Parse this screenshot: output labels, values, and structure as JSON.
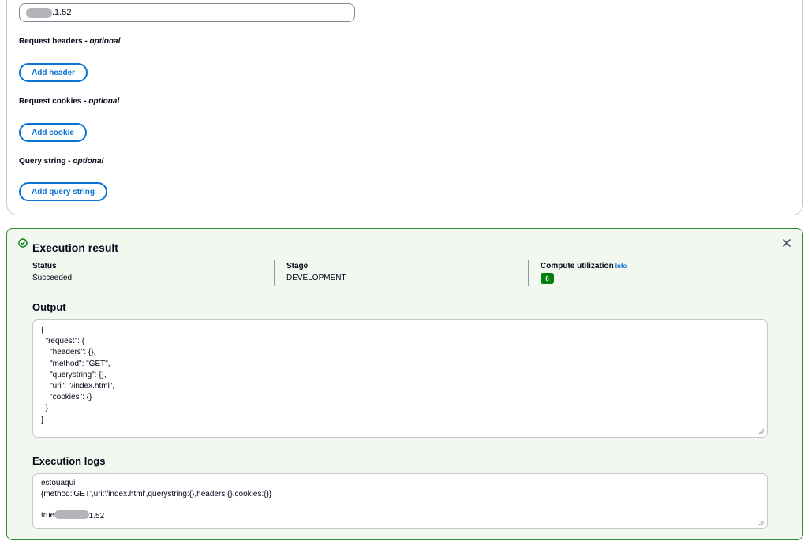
{
  "form": {
    "ip_value_suffix": ".1.52",
    "headers_label": "Request headers - ",
    "headers_optional": "optional",
    "add_header_label": "Add header",
    "cookies_label": "Request cookies - ",
    "cookies_optional": "optional",
    "add_cookie_label": "Add cookie",
    "query_label": "Query string - ",
    "query_optional": "optional",
    "add_query_label": "Add query string"
  },
  "result": {
    "title": "Execution result",
    "status_label": "Status",
    "status_value": "Succeeded",
    "stage_label": "Stage",
    "stage_value": "DEVELOPMENT",
    "compute_label": "Compute utilization",
    "info_link": "Info",
    "compute_value": "6",
    "output_heading": "Output",
    "output_lines": [
      "{",
      "  \"request\": {",
      "    \"headers\": {},",
      "    \"method\": \"GET\",",
      "    \"querystring\": {},",
      "    \"uri\": \"/index.html\",",
      "    \"cookies\": {}",
      "  }",
      "}"
    ],
    "logs_heading": "Execution logs",
    "log_line_1": "estouaqui",
    "log_line_2": "{method:'GET',uri:'/index.html',querystring:{},headers:{},cookies:{}}",
    "log_line_3_suffix": "1.52",
    "log_line_4": "true"
  },
  "colors": {
    "accent": "#0972d3",
    "success": "#037f0c",
    "panel_bg": "#f2f8f0",
    "panel_border": "#2e8b2e"
  }
}
